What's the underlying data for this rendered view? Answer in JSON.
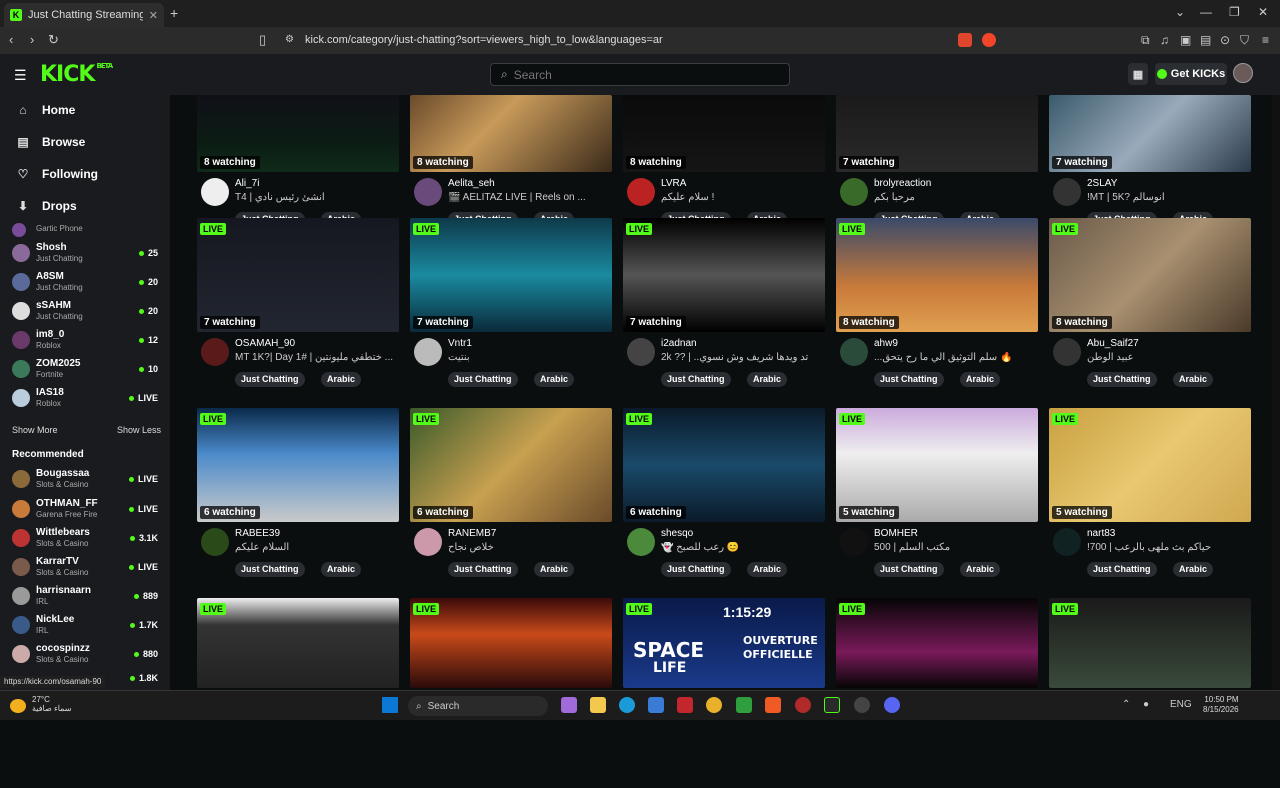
{
  "browser": {
    "tab_title": "Just Chatting Streaming - Live S",
    "new_tab": "+",
    "url": "kick.com/category/just-chatting?sort=viewers_high_to_low&languages=ar",
    "status_url": "https://kick.com/osamah-90"
  },
  "header": {
    "logo": "KICK",
    "beta": "BETA",
    "search_placeholder": "Search",
    "get_kicks": "Get KICKs"
  },
  "sidebar": {
    "nav": [
      {
        "label": "Home",
        "icon": "home-icon"
      },
      {
        "label": "Browse",
        "icon": "browse-icon"
      },
      {
        "label": "Following",
        "icon": "heart-icon"
      },
      {
        "label": "Drops",
        "icon": "drops-icon"
      }
    ],
    "following": [
      {
        "name": "Gartic Phone",
        "category": "",
        "viewers": ""
      },
      {
        "name": "Shosh",
        "category": "Just Chatting",
        "viewers": "25"
      },
      {
        "name": "A8SM",
        "category": "Just Chatting",
        "viewers": "20"
      },
      {
        "name": "sSAHM",
        "category": "Just Chatting",
        "viewers": "20"
      },
      {
        "name": "im8_0",
        "category": "Roblox",
        "viewers": "12"
      },
      {
        "name": "ZOM2025",
        "category": "Fortnite",
        "viewers": "10"
      },
      {
        "name": "IAS18",
        "category": "Roblox",
        "viewers": "LIVE"
      }
    ],
    "show_more": "Show More",
    "show_less": "Show Less",
    "recommended_heading": "Recommended",
    "recommended": [
      {
        "name": "Bougassaa",
        "category": "Slots & Casino",
        "viewers": "LIVE"
      },
      {
        "name": "OTHMAN_FF",
        "category": "Garena Free Fire",
        "viewers": "LIVE"
      },
      {
        "name": "Wittlebears",
        "category": "Slots & Casino",
        "viewers": "3.1K"
      },
      {
        "name": "KarrarTV",
        "category": "Slots & Casino",
        "viewers": "LIVE"
      },
      {
        "name": "harrisnaarn",
        "category": "IRL",
        "viewers": "889"
      },
      {
        "name": "NickLee",
        "category": "IRL",
        "viewers": "1.7K"
      },
      {
        "name": "cocospinzz",
        "category": "Slots & Casino",
        "viewers": "880"
      },
      {
        "name": "",
        "category": "",
        "viewers": "1.8K"
      }
    ]
  },
  "tags": {
    "category": "Just Chatting",
    "language": "Arabic"
  },
  "live_badge": "LIVE",
  "streams": [
    {
      "watching": "8 watching",
      "name": "Ali_7i",
      "title": "T4 | انشئ رئيس نادي",
      "live": false
    },
    {
      "watching": "8 watching",
      "name": "Aelita_seh",
      "title": "🎬 AELITAZ LIVE | Reels on ...",
      "live": false
    },
    {
      "watching": "8 watching",
      "name": "LVRA",
      "title": "سلام عليكم !",
      "live": false
    },
    {
      "watching": "7 watching",
      "name": "brolyreaction",
      "title": "مرحبا بكم",
      "live": false
    },
    {
      "watching": "7 watching",
      "name": "2SLAY",
      "title": "!MT | 5K? انوسالم",
      "live": false
    },
    {
      "watching": "7 watching",
      "name": "OSAMAH_90",
      "title": "MT 1K?| Day 1# | ختطفي مليونتين ...",
      "live": true
    },
    {
      "watching": "7 watching",
      "name": "Vntr1",
      "title": "بنتيت",
      "live": true
    },
    {
      "watching": "7 watching",
      "name": "i2adnan",
      "title": "2k ?? | ..تد ويدهآ شريف وش نسوي",
      "live": true
    },
    {
      "watching": "8 watching",
      "name": "ahw9",
      "title": "...سلم التوثيق الي ما رح يتحق 🔥",
      "live": true
    },
    {
      "watching": "8 watching",
      "name": "Abu_Saif27",
      "title": "عبيد الوطن",
      "live": true
    },
    {
      "watching": "6 watching",
      "name": "RABEE39",
      "title": "السلام عليكم",
      "live": true
    },
    {
      "watching": "6 watching",
      "name": "RANEMB7",
      "title": "خلاص نجاح",
      "live": true
    },
    {
      "watching": "6 watching",
      "name": "shesqo",
      "title": "👻 رعب للصبح 😊",
      "live": true
    },
    {
      "watching": "5 watching",
      "name": "BOMHER",
      "title": "500 | مكتب السلم",
      "live": true
    },
    {
      "watching": "5 watching",
      "name": "nart83",
      "title": "!700 | حياكم بث ملهى بالرعب",
      "live": true
    },
    {
      "watching": "",
      "name": "",
      "title": "",
      "live": true
    },
    {
      "watching": "",
      "name": "",
      "title": "",
      "live": true
    },
    {
      "watching": "",
      "name": "",
      "title": "",
      "live": true,
      "timer": "1:15:29",
      "overlay_1": "SPACE",
      "overlay_2": "LIFE",
      "overlay_3": "OUVERTURE",
      "overlay_4": "OFFICIELLE"
    },
    {
      "watching": "",
      "name": "",
      "title": "",
      "live": true
    },
    {
      "watching": "",
      "name": "",
      "title": "",
      "live": true
    }
  ],
  "taskbar": {
    "weather_temp": "27°C",
    "weather_desc": "سماء صافية",
    "search": "Search",
    "time": "10:50 PM",
    "date": "8/15/2026"
  },
  "colors": {
    "accent": "#53fc18",
    "background": "#0b0e0f",
    "surface": "#191b1f",
    "tag": "#2a2d31"
  }
}
